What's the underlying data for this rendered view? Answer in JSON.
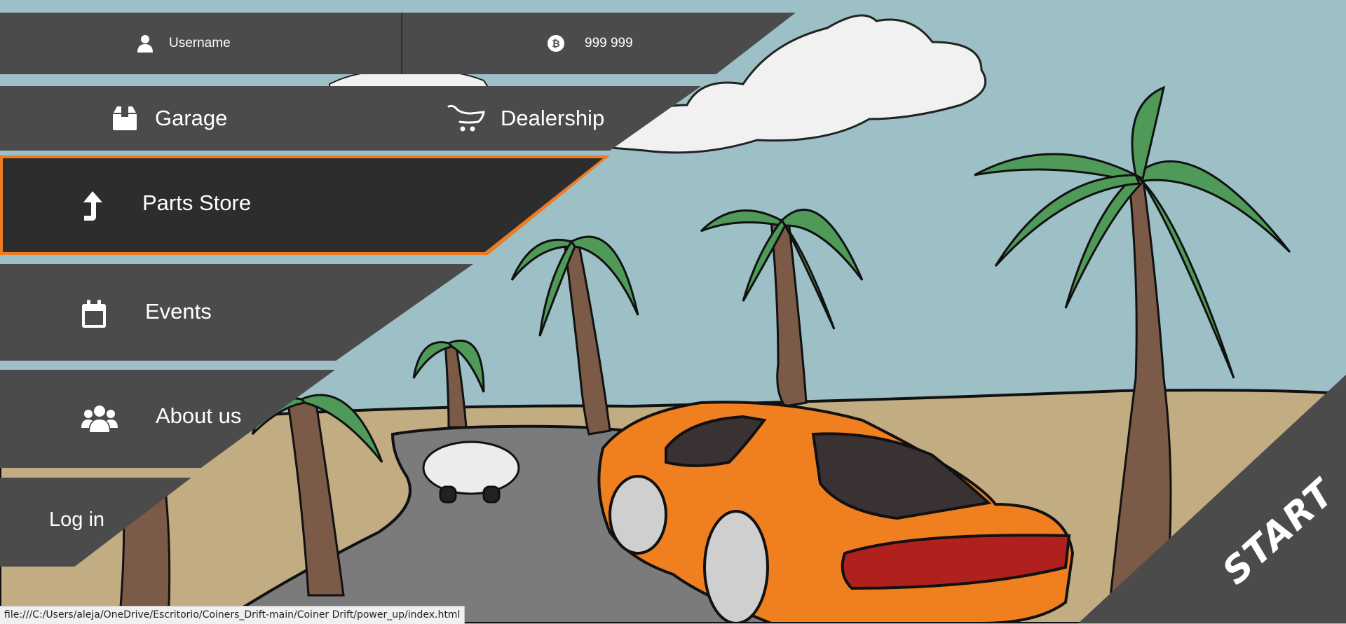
{
  "user": {
    "username": "Username",
    "coins": "999 999"
  },
  "menu": {
    "garage": "Garage",
    "dealership": "Dealership",
    "parts_store": "Parts Store",
    "events": "Events",
    "about_us": "About us",
    "log_in": "Log in"
  },
  "start_label": "START",
  "status_url": "file:///C:/Users/aleja/OneDrive/Escritorio/Coiners_Drift-main/Coiner Drift/power_up/index.html",
  "icons": {
    "user": "user-icon",
    "coin": "bitcoin-coin-icon",
    "garage": "box-icon",
    "dealership": "cart-icon",
    "parts_store": "turn-up-arrow-icon",
    "events": "calendar-icon",
    "about_us": "group-icon"
  },
  "colors": {
    "panel": "#4b4b4b",
    "panel_active": "#2d2d2d",
    "accent": "#ee7a22",
    "sky": "#9dc0c6",
    "sand": "#c2ad82",
    "road": "#7b7b7b",
    "car_main": "#f07f20"
  }
}
